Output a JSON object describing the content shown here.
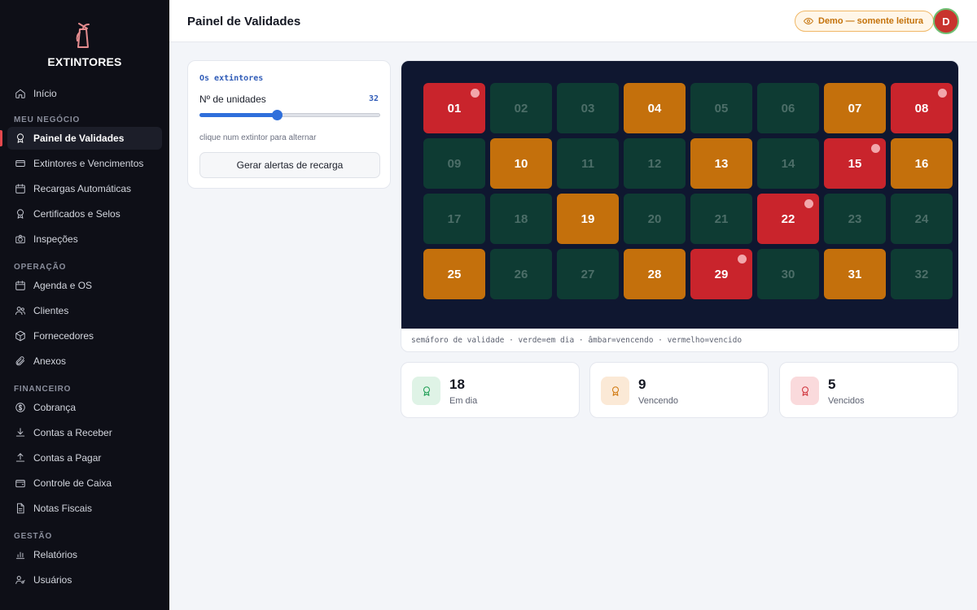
{
  "brand": {
    "name": "EXTINTORES",
    "icon": "fire-extinguisher-icon"
  },
  "sidebar": {
    "top": [
      {
        "label": "Início",
        "icon": "home-icon"
      }
    ],
    "sections": [
      {
        "title": "MEU NEGÓCIO",
        "items": [
          {
            "label": "Painel de Validades",
            "icon": "award-icon",
            "active": true
          },
          {
            "label": "Extintores e Vencimentos",
            "icon": "card-icon"
          },
          {
            "label": "Recargas Automáticas",
            "icon": "calendar-icon"
          },
          {
            "label": "Certificados e Selos",
            "icon": "award-icon"
          },
          {
            "label": "Inspeções",
            "icon": "camera-icon"
          }
        ]
      },
      {
        "title": "OPERAÇÃO",
        "items": [
          {
            "label": "Agenda e OS",
            "icon": "calendar-icon"
          },
          {
            "label": "Clientes",
            "icon": "users-icon"
          },
          {
            "label": "Fornecedores",
            "icon": "package-icon"
          },
          {
            "label": "Anexos",
            "icon": "paperclip-icon"
          }
        ]
      },
      {
        "title": "FINANCEIRO",
        "items": [
          {
            "label": "Cobrança",
            "icon": "dollar-icon"
          },
          {
            "label": "Contas a Receber",
            "icon": "download-icon"
          },
          {
            "label": "Contas a Pagar",
            "icon": "upload-icon"
          },
          {
            "label": "Controle de Caixa",
            "icon": "wallet-icon"
          },
          {
            "label": "Notas Fiscais",
            "icon": "file-icon"
          }
        ]
      },
      {
        "title": "GESTÃO",
        "items": [
          {
            "label": "Relatórios",
            "icon": "bar-chart-icon"
          },
          {
            "label": "Usuários",
            "icon": "user-key-icon"
          }
        ]
      }
    ]
  },
  "header": {
    "title": "Painel de Validades",
    "demo_badge": "Demo — somente leitura",
    "avatar_initial": "D"
  },
  "control": {
    "title": "Os extintores",
    "label": "Nº de unidades",
    "value": "32",
    "slider_fraction": 0.43,
    "hint": "clique num extintor para alternar",
    "button": "Gerar alertas de recarga"
  },
  "grid": {
    "columns": 8,
    "colors": {
      "green": "#0e3b33",
      "amber": "#c4700c",
      "red": "#c9242c"
    },
    "tiles": [
      {
        "label": "01",
        "status": "red"
      },
      {
        "label": "02",
        "status": "green"
      },
      {
        "label": "03",
        "status": "green"
      },
      {
        "label": "04",
        "status": "amber"
      },
      {
        "label": "05",
        "status": "green"
      },
      {
        "label": "06",
        "status": "green"
      },
      {
        "label": "07",
        "status": "amber"
      },
      {
        "label": "08",
        "status": "red"
      },
      {
        "label": "09",
        "status": "green"
      },
      {
        "label": "10",
        "status": "amber"
      },
      {
        "label": "11",
        "status": "green"
      },
      {
        "label": "12",
        "status": "green"
      },
      {
        "label": "13",
        "status": "amber"
      },
      {
        "label": "14",
        "status": "green"
      },
      {
        "label": "15",
        "status": "red"
      },
      {
        "label": "16",
        "status": "amber"
      },
      {
        "label": "17",
        "status": "green"
      },
      {
        "label": "18",
        "status": "green"
      },
      {
        "label": "19",
        "status": "amber"
      },
      {
        "label": "20",
        "status": "green"
      },
      {
        "label": "21",
        "status": "green"
      },
      {
        "label": "22",
        "status": "red"
      },
      {
        "label": "23",
        "status": "green"
      },
      {
        "label": "24",
        "status": "green"
      },
      {
        "label": "25",
        "status": "amber"
      },
      {
        "label": "26",
        "status": "green"
      },
      {
        "label": "27",
        "status": "green"
      },
      {
        "label": "28",
        "status": "amber"
      },
      {
        "label": "29",
        "status": "red"
      },
      {
        "label": "30",
        "status": "green"
      },
      {
        "label": "31",
        "status": "amber"
      },
      {
        "label": "32",
        "status": "green"
      }
    ],
    "caption": "semáforo de validade · verde=em dia · âmbar=vencendo · vermelho=vencido"
  },
  "stats": [
    {
      "value": "18",
      "label": "Em dia",
      "color": "#1e9e55",
      "bg": "#dff3e6",
      "icon": "award-icon"
    },
    {
      "value": "9",
      "label": "Vencendo",
      "color": "#d0780e",
      "bg": "#fbe9d6",
      "icon": "award-icon"
    },
    {
      "value": "5",
      "label": "Vencidos",
      "color": "#d0343c",
      "bg": "#fadadc",
      "icon": "award-icon"
    }
  ]
}
